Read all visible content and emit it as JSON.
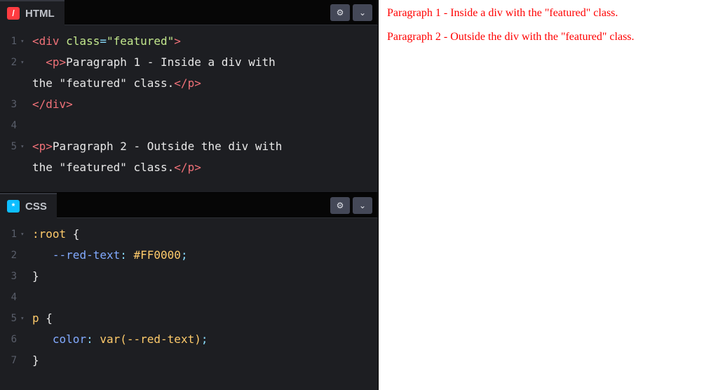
{
  "editors": {
    "html": {
      "label": "HTML",
      "iconGlyph": "/",
      "lineNumbers": [
        "1",
        "2",
        "",
        "3",
        "4",
        "5",
        ""
      ],
      "code": {
        "l1_open": "<div",
        "l1_attr": " class",
        "l1_eq": "=",
        "l1_val": "\"featured\"",
        "l1_close": ">",
        "l2_open": "<p>",
        "l2_text_a": "Paragraph 1 - Inside a div with ",
        "l2_text_b": "the \"featured\" class.",
        "l2_close": "</p>",
        "l3": "</div>",
        "l5_open": "<p>",
        "l5_text_a": "Paragraph 2 - Outside the div with ",
        "l5_text_b": "the \"featured\" class.",
        "l5_close": "</p>"
      }
    },
    "css": {
      "label": "CSS",
      "iconGlyph": "*",
      "lineNumbers": [
        "1",
        "2",
        "3",
        "4",
        "5",
        "6",
        "7"
      ],
      "code": {
        "l1_sel": ":root",
        "l1_brace": " {",
        "l2_prop": "--red-text",
        "l2_colon": ": ",
        "l2_val": "#FF0000",
        "l2_semi": ";",
        "l3_brace": "}",
        "l5_sel": "p",
        "l5_brace": " {",
        "l6_prop": "color",
        "l6_colon": ": ",
        "l6_val": "var(--red-text)",
        "l6_semi": ";",
        "l7_brace": "}"
      }
    }
  },
  "preview": {
    "p1": "Paragraph 1 - Inside a div with the \"featured\" class.",
    "p2": "Paragraph 2 - Outside the div with the \"featured\" class."
  },
  "icons": {
    "gear": "⚙",
    "chevronDown": "⌄"
  }
}
